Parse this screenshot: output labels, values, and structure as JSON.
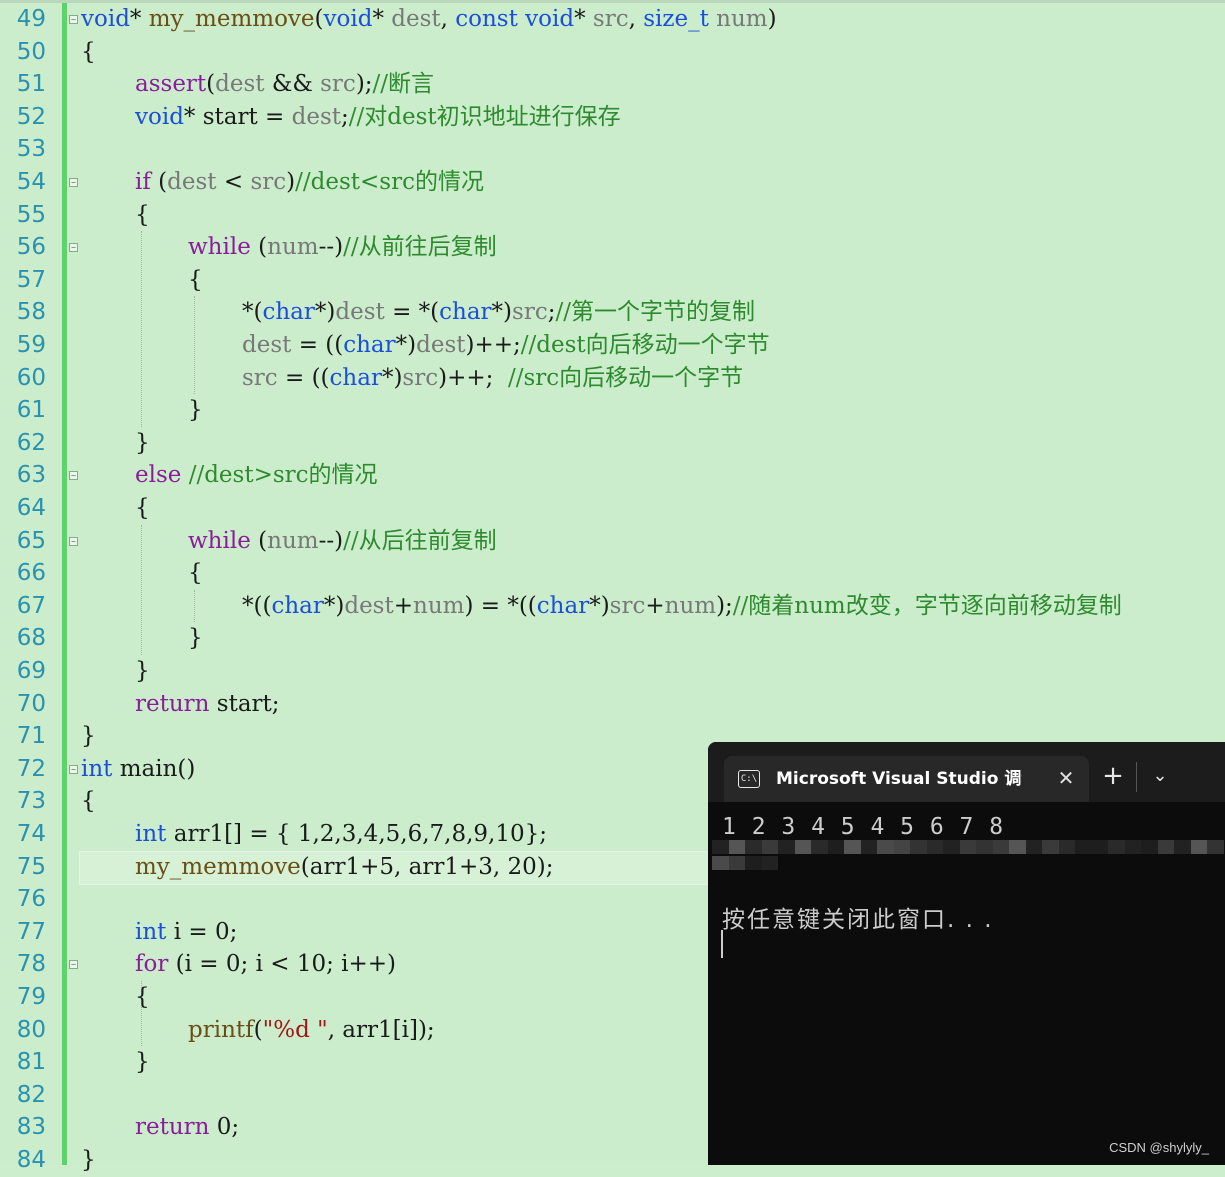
{
  "editor": {
    "line_numbers": [
      "49",
      "50",
      "51",
      "52",
      "53",
      "54",
      "55",
      "56",
      "57",
      "58",
      "59",
      "60",
      "61",
      "62",
      "63",
      "64",
      "65",
      "66",
      "67",
      "68",
      "69",
      "70",
      "71",
      "72",
      "73",
      "74",
      "75",
      "76",
      "77",
      "78",
      "79",
      "80",
      "81",
      "82",
      "83",
      "84"
    ],
    "lines": [
      [
        [
          "kw",
          "void"
        ],
        [
          "",
          "* "
        ],
        [
          "fn",
          "my_memmove"
        ],
        [
          "",
          "("
        ],
        [
          "kw",
          "void"
        ],
        [
          "",
          "* "
        ],
        [
          "pm",
          "dest"
        ],
        [
          "",
          ", "
        ],
        [
          "kw",
          "const"
        ],
        [
          "",
          " "
        ],
        [
          "kw",
          "void"
        ],
        [
          "",
          "* "
        ],
        [
          "pm",
          "src"
        ],
        [
          "",
          ", "
        ],
        [
          "kw",
          "size_t"
        ],
        [
          "",
          " "
        ],
        [
          "pm",
          "num"
        ],
        [
          "",
          ")"
        ]
      ],
      [
        [
          "",
          "{"
        ]
      ],
      [
        [
          "",
          ""
        ],
        [
          "pur",
          "assert"
        ],
        [
          "",
          "("
        ],
        [
          "pm",
          "dest"
        ],
        [
          "",
          " && "
        ],
        [
          "pm",
          "src"
        ],
        [
          "",
          ");"
        ],
        [
          "cm",
          "//断言"
        ]
      ],
      [
        [
          "",
          ""
        ],
        [
          "kw",
          "void"
        ],
        [
          "",
          "* start = "
        ],
        [
          "pm",
          "dest"
        ],
        [
          "",
          ";"
        ],
        [
          "cm",
          "//对dest初识地址进行保存"
        ]
      ],
      [
        [
          "",
          ""
        ]
      ],
      [
        [
          "",
          ""
        ],
        [
          "pur",
          "if"
        ],
        [
          "",
          " ("
        ],
        [
          "pm",
          "dest"
        ],
        [
          "",
          " < "
        ],
        [
          "pm",
          "src"
        ],
        [
          "",
          ")"
        ],
        [
          "cm",
          "//dest<src的情况"
        ]
      ],
      [
        [
          "",
          "{"
        ]
      ],
      [
        [
          "",
          ""
        ],
        [
          "pur",
          "while"
        ],
        [
          "",
          " ("
        ],
        [
          "pm",
          "num"
        ],
        [
          "",
          "--)"
        ],
        [
          "cm",
          "//从前往后复制"
        ]
      ],
      [
        [
          "",
          "{"
        ]
      ],
      [
        [
          "",
          "*("
        ],
        [
          "kw",
          "char"
        ],
        [
          "",
          "*)"
        ],
        [
          "pm",
          "dest"
        ],
        [
          "",
          " = *("
        ],
        [
          "kw",
          "char"
        ],
        [
          "",
          "*)"
        ],
        [
          "pm",
          "src"
        ],
        [
          "",
          ";"
        ],
        [
          "cm",
          "//第一个字节的复制"
        ]
      ],
      [
        [
          "pm",
          "dest"
        ],
        [
          "",
          " = (("
        ],
        [
          "kw",
          "char"
        ],
        [
          "",
          "*)"
        ],
        [
          "pm",
          "dest"
        ],
        [
          "",
          ")++;"
        ],
        [
          "cm",
          "//dest向后移动一个字节"
        ]
      ],
      [
        [
          "pm",
          "src"
        ],
        [
          "",
          " = (("
        ],
        [
          "kw",
          "char"
        ],
        [
          "",
          "*)"
        ],
        [
          "pm",
          "src"
        ],
        [
          "",
          ")++;  "
        ],
        [
          "cm",
          "//src向后移动一个字节"
        ]
      ],
      [
        [
          "",
          "}"
        ]
      ],
      [
        [
          "",
          "}"
        ]
      ],
      [
        [
          "pur",
          "else"
        ],
        [
          "",
          " "
        ],
        [
          "cm",
          "//dest>src的情况"
        ]
      ],
      [
        [
          "",
          "{"
        ]
      ],
      [
        [
          "pur",
          "while"
        ],
        [
          "",
          " ("
        ],
        [
          "pm",
          "num"
        ],
        [
          "",
          "--)"
        ],
        [
          "cm",
          "//从后往前复制"
        ]
      ],
      [
        [
          "",
          "{"
        ]
      ],
      [
        [
          "",
          "*(("
        ],
        [
          "kw",
          "char"
        ],
        [
          "",
          "*)"
        ],
        [
          "pm",
          "dest"
        ],
        [
          "",
          "+"
        ],
        [
          "pm",
          "num"
        ],
        [
          "",
          ") = *(("
        ],
        [
          "kw",
          "char"
        ],
        [
          "",
          "*)"
        ],
        [
          "pm",
          "src"
        ],
        [
          "",
          "+"
        ],
        [
          "pm",
          "num"
        ],
        [
          "",
          ");"
        ],
        [
          "cm",
          "//随着num改变，字节逐向前移动复制"
        ]
      ],
      [
        [
          "",
          "}"
        ]
      ],
      [
        [
          "",
          "}"
        ]
      ],
      [
        [
          "pur",
          "return"
        ],
        [
          "",
          " start;"
        ]
      ],
      [
        [
          "",
          "}"
        ]
      ],
      [
        [
          "kw",
          "int"
        ],
        [
          "",
          " main()"
        ]
      ],
      [
        [
          "",
          "{"
        ]
      ],
      [
        [
          "kw",
          "int"
        ],
        [
          "",
          " arr1[] = { 1,2,3,4,5,6,7,8,9,10};"
        ]
      ],
      [
        [
          "fn",
          "my_memmove"
        ],
        [
          "",
          "(arr1+5, arr1+3, 20);"
        ]
      ],
      [
        [
          "",
          ""
        ]
      ],
      [
        [
          "kw",
          "int"
        ],
        [
          "",
          " i = 0;"
        ]
      ],
      [
        [
          "pur",
          "for"
        ],
        [
          "",
          " (i = 0; i < 10; i++)"
        ]
      ],
      [
        [
          "",
          "{"
        ]
      ],
      [
        [
          "fn",
          "printf"
        ],
        [
          "",
          "("
        ],
        [
          "str",
          "\"%d \""
        ],
        [
          "",
          ", arr1[i]);"
        ]
      ],
      [
        [
          "",
          "}"
        ]
      ],
      [
        [
          "",
          ""
        ]
      ],
      [
        [
          "pur",
          "return"
        ],
        [
          "",
          " 0;"
        ]
      ],
      [
        [
          "",
          "}"
        ]
      ]
    ]
  },
  "console": {
    "tab_title": "Microsoft Visual Studio 调试控制台",
    "tab_icon_text": "C:\\",
    "close_glyph": "✕",
    "new_tab_glyph": "+",
    "dropdown_glyph": "⌄",
    "output_line": "1 2 3 4 5 4 5 6 7 8",
    "prompt_line": "按任意键关闭此窗口. . ."
  },
  "watermark": "CSDN @shylyly_"
}
